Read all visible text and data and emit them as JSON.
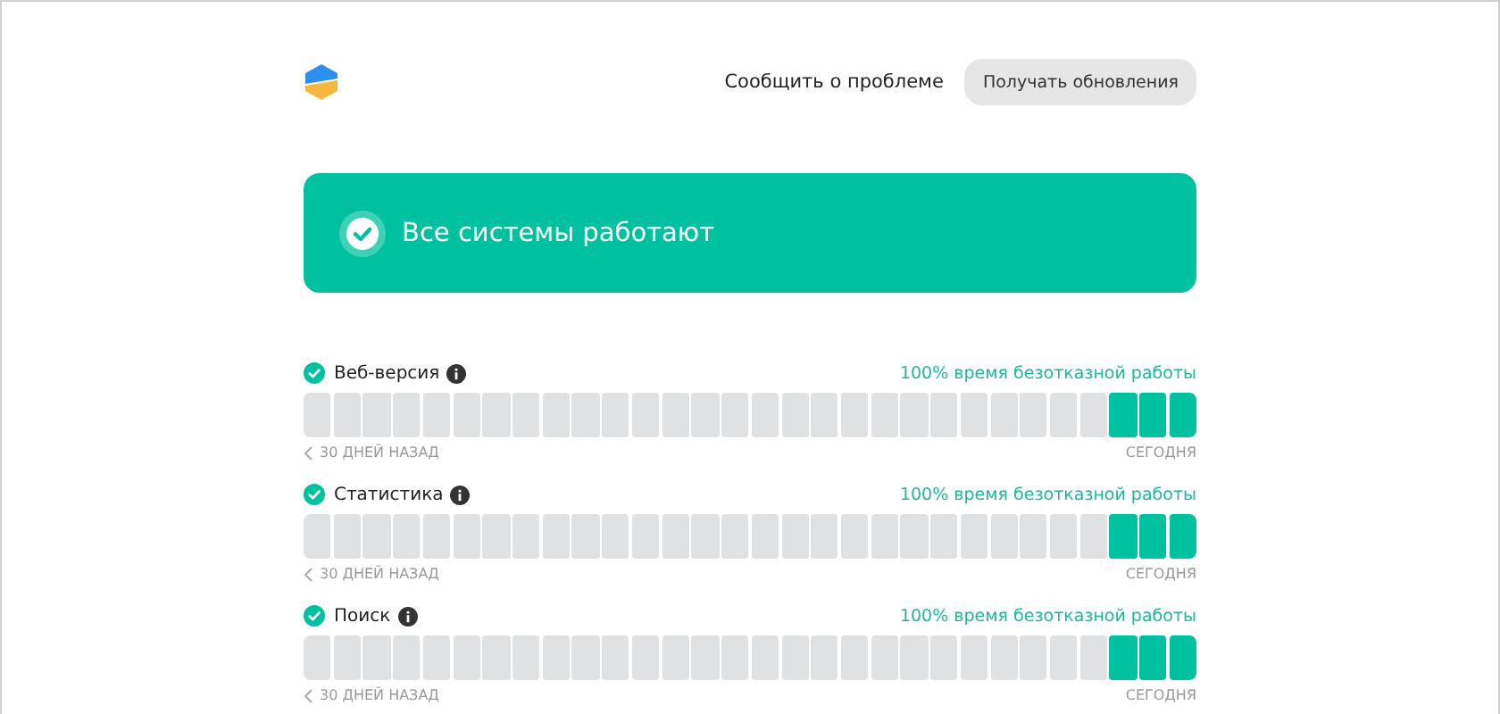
{
  "header": {
    "report_link": "Сообщить о проблеме",
    "subscribe_button": "Получать обновления"
  },
  "banner": {
    "operational": true,
    "text": "Все системы работают"
  },
  "services": [
    {
      "name": "Веб-версия",
      "operational": true,
      "uptime": "100% время безотказной работы",
      "start_label": "30 ДНЕЙ НАЗАД",
      "end_label": "СЕГОДНЯ",
      "days": [
        {
          "up": false
        },
        {
          "up": false
        },
        {
          "up": false
        },
        {
          "up": false
        },
        {
          "up": false
        },
        {
          "up": false
        },
        {
          "up": false
        },
        {
          "up": false
        },
        {
          "up": false
        },
        {
          "up": false
        },
        {
          "up": false
        },
        {
          "up": false
        },
        {
          "up": false
        },
        {
          "up": false
        },
        {
          "up": false
        },
        {
          "up": false
        },
        {
          "up": false
        },
        {
          "up": false
        },
        {
          "up": false
        },
        {
          "up": false
        },
        {
          "up": false
        },
        {
          "up": false
        },
        {
          "up": false
        },
        {
          "up": false
        },
        {
          "up": false
        },
        {
          "up": false
        },
        {
          "up": false
        },
        {
          "up": true
        },
        {
          "up": true
        },
        {
          "up": true
        }
      ]
    },
    {
      "name": "Статистика",
      "operational": true,
      "uptime": "100% время безотказной работы",
      "start_label": "30 ДНЕЙ НАЗАД",
      "end_label": "СЕГОДНЯ",
      "days": [
        {
          "up": false
        },
        {
          "up": false
        },
        {
          "up": false
        },
        {
          "up": false
        },
        {
          "up": false
        },
        {
          "up": false
        },
        {
          "up": false
        },
        {
          "up": false
        },
        {
          "up": false
        },
        {
          "up": false
        },
        {
          "up": false
        },
        {
          "up": false
        },
        {
          "up": false
        },
        {
          "up": false
        },
        {
          "up": false
        },
        {
          "up": false
        },
        {
          "up": false
        },
        {
          "up": false
        },
        {
          "up": false
        },
        {
          "up": false
        },
        {
          "up": false
        },
        {
          "up": false
        },
        {
          "up": false
        },
        {
          "up": false
        },
        {
          "up": false
        },
        {
          "up": false
        },
        {
          "up": false
        },
        {
          "up": true
        },
        {
          "up": true
        },
        {
          "up": true
        }
      ]
    },
    {
      "name": "Поиск",
      "operational": true,
      "uptime": "100% время безотказной работы",
      "start_label": "30 ДНЕЙ НАЗАД",
      "end_label": "СЕГОДНЯ",
      "days": [
        {
          "up": false
        },
        {
          "up": false
        },
        {
          "up": false
        },
        {
          "up": false
        },
        {
          "up": false
        },
        {
          "up": false
        },
        {
          "up": false
        },
        {
          "up": false
        },
        {
          "up": false
        },
        {
          "up": false
        },
        {
          "up": false
        },
        {
          "up": false
        },
        {
          "up": false
        },
        {
          "up": false
        },
        {
          "up": false
        },
        {
          "up": false
        },
        {
          "up": false
        },
        {
          "up": false
        },
        {
          "up": false
        },
        {
          "up": false
        },
        {
          "up": false
        },
        {
          "up": false
        },
        {
          "up": false
        },
        {
          "up": false
        },
        {
          "up": false
        },
        {
          "up": false
        },
        {
          "up": false
        },
        {
          "up": true
        },
        {
          "up": true
        },
        {
          "up": true
        }
      ]
    }
  ]
}
